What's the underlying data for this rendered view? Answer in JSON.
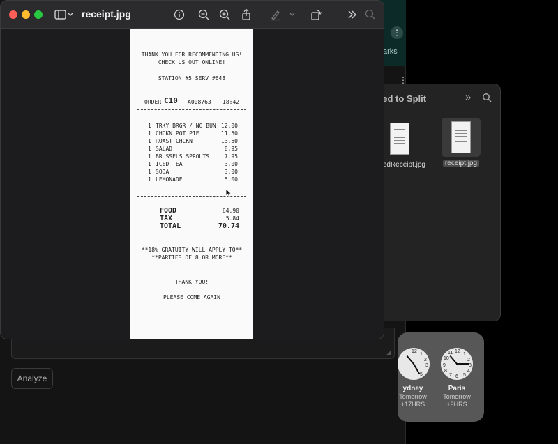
{
  "preview": {
    "title": "receipt.jpg"
  },
  "receipt": {
    "header1": "THANK YOU FOR RECOMMENDING US!",
    "header2": "CHECK US OUT ONLINE!",
    "station": "STATION #5 SERV #648",
    "order_label": "ORDER",
    "order_code": "C10",
    "order_number": "A008763",
    "order_time": "18:42",
    "items": [
      {
        "qty": "1",
        "name": "TRKY BRGR / NO BUN",
        "price": "12.00"
      },
      {
        "qty": "1",
        "name": "CHCKN POT PIE",
        "price": "11.50"
      },
      {
        "qty": "1",
        "name": "ROAST CHCKN",
        "price": "13.50"
      },
      {
        "qty": "1",
        "name": "SALAD",
        "price": "8.95"
      },
      {
        "qty": "1",
        "name": "BRUSSELS SPROUTS",
        "price": "7.95"
      },
      {
        "qty": "1",
        "name": "ICED TEA",
        "price": "3.00"
      },
      {
        "qty": "1",
        "name": "SODA",
        "price": "3.00"
      },
      {
        "qty": "1",
        "name": "LEMONADE",
        "price": "5.00"
      }
    ],
    "food_label": "FOOD",
    "food_value": "64.90",
    "tax_label": "TAX",
    "tax_value": "5.84",
    "total_label": "TOTAL",
    "total_value": "70.74",
    "gratuity1": "**18% GRATUITY WILL APPLY TO**",
    "gratuity2": "**PARTIES OF 8 OR MORE**",
    "thanks": "THANK YOU!",
    "come_again": "PLEASE COME AGAIN"
  },
  "finder": {
    "title": "eed to Split",
    "files": [
      {
        "name": "nizedReceipt.jpg"
      },
      {
        "name": "receipt.jpg"
      }
    ]
  },
  "background": {
    "bookmarks_fragment": "arks",
    "analyze_label": "Analyze"
  },
  "clocks": [
    {
      "city": "ydney",
      "day": "Tomorrow",
      "offset": "+17HRS"
    },
    {
      "city": "Paris",
      "day": "Tomorrow",
      "offset": "+9HRS"
    }
  ],
  "icons": {
    "toolbar": [
      "sidebar-icon",
      "chevron-down-icon",
      "info-icon",
      "zoom-out-icon",
      "zoom-in-icon",
      "share-icon",
      "markup-icon",
      "rotate-icon",
      "more-chevron-icon",
      "search-icon"
    ]
  }
}
